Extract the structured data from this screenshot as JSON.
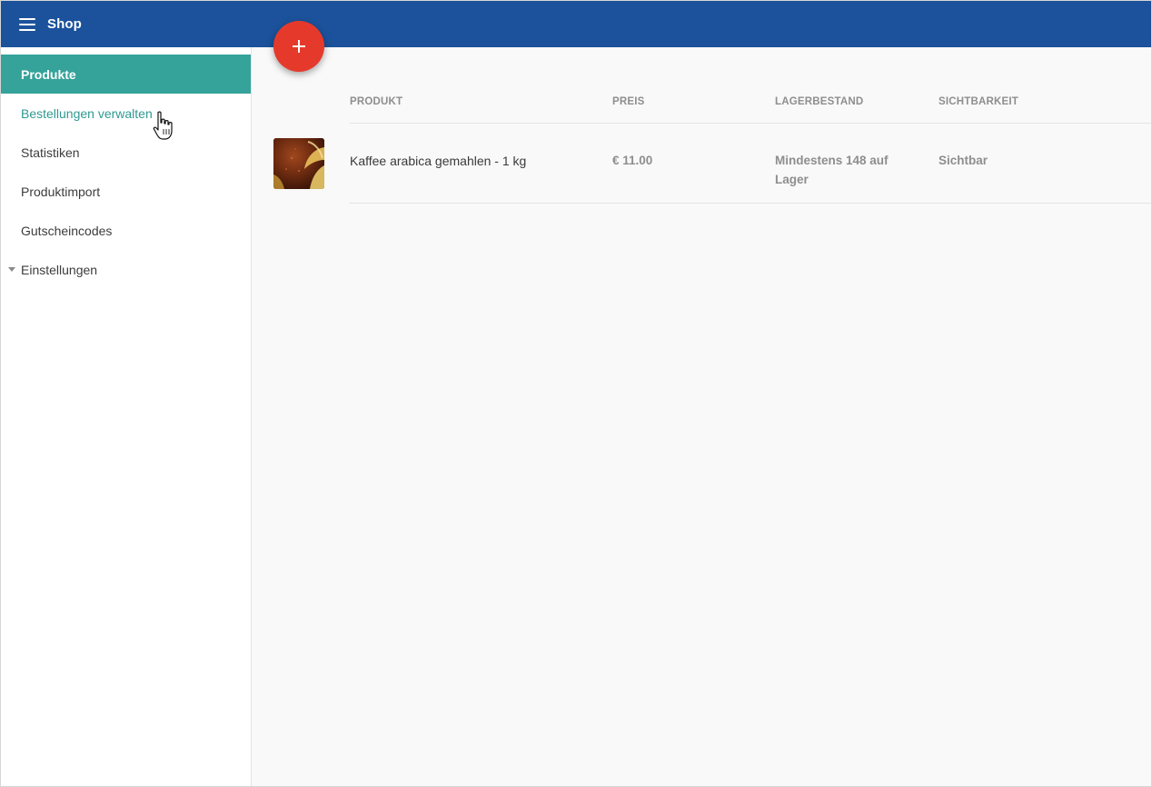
{
  "header": {
    "title": "Shop",
    "menu_icon": "hamburger-menu-icon",
    "background": "#1b529b"
  },
  "sidebar": {
    "items": [
      {
        "label": "Produkte",
        "state": "active"
      },
      {
        "label": "Bestellungen verwalten",
        "state": "hover"
      },
      {
        "label": "Statistiken"
      },
      {
        "label": "Produktimport"
      },
      {
        "label": "Gutscheincodes"
      },
      {
        "label": "Einstellungen",
        "expandable": true,
        "icon": "caret-down-icon"
      }
    ],
    "active_color": "#35a39a"
  },
  "fab": {
    "symbol": "+",
    "icon": "plus-icon",
    "color": "#e53a2b"
  },
  "table": {
    "columns": [
      "PRODUKT",
      "PREIS",
      "LAGERBESTAND",
      "SICHTBARKEIT"
    ],
    "rows": [
      {
        "thumbnail": "coffee-product-image",
        "name": "Kaffee arabica gemahlen - 1 kg",
        "price": "€ 11.00",
        "stock": "Mindestens 148 auf Lager",
        "visibility": "Sichtbar"
      }
    ]
  }
}
